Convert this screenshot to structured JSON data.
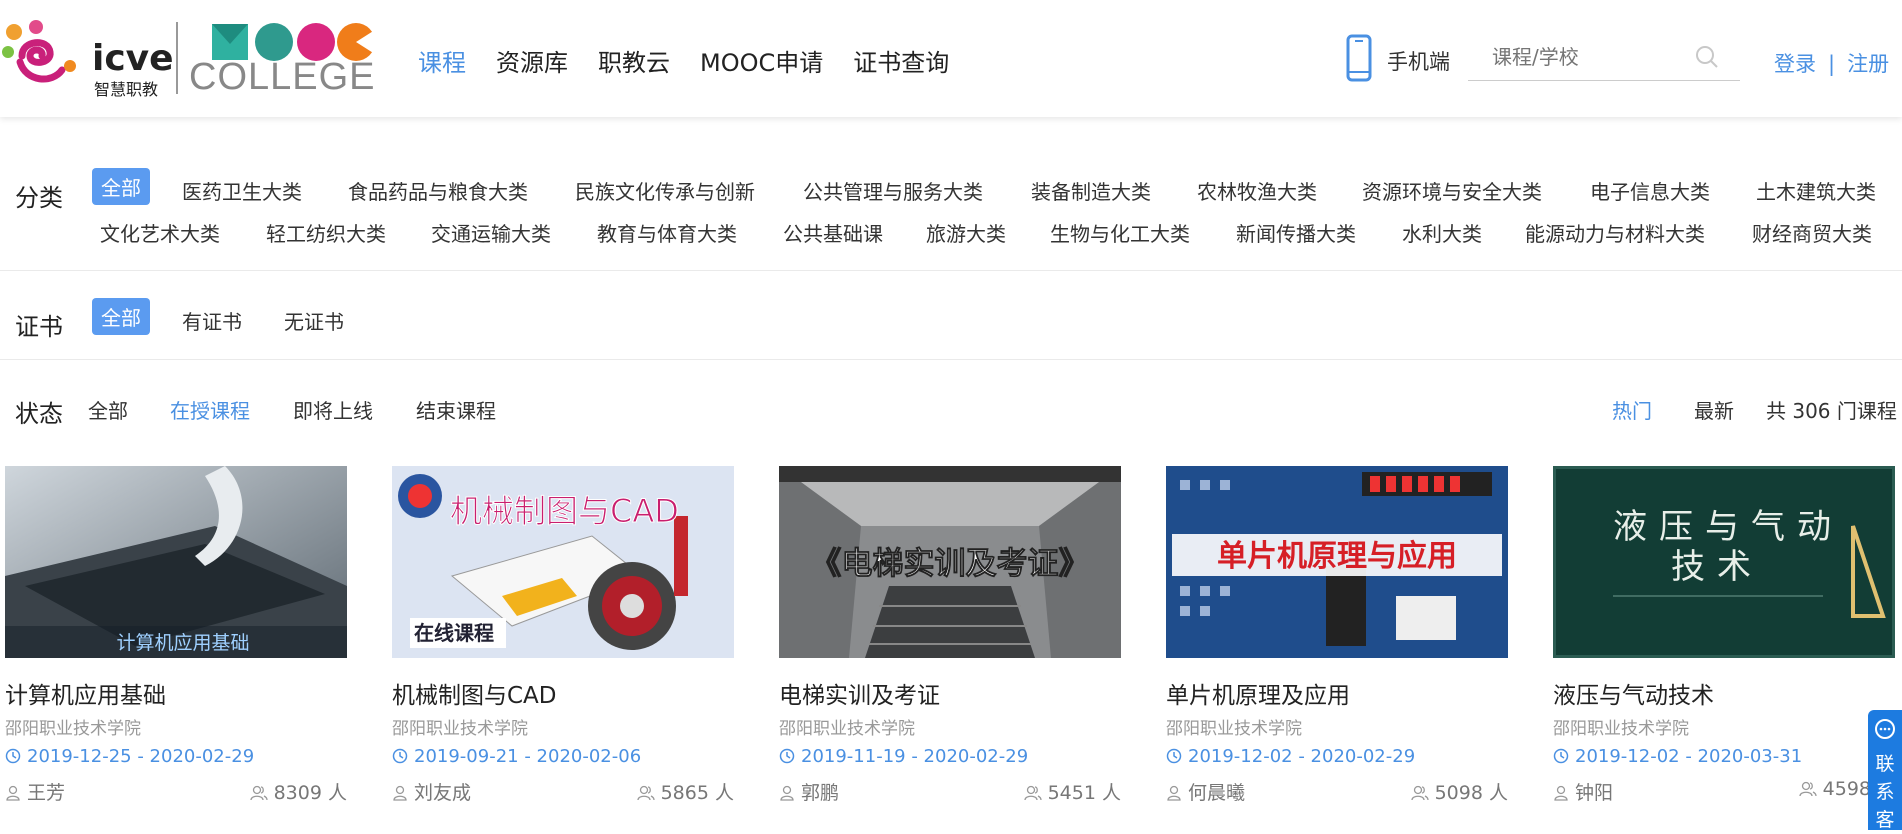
{
  "header": {
    "logo": {
      "icve": "icve",
      "icve_sub": "智慧职教",
      "mooc": "MOOC",
      "college": "COLLEGE"
    },
    "nav": [
      "课程",
      "资源库",
      "职教云",
      "MOOC申请",
      "证书查询"
    ],
    "active_nav": "课程",
    "phone_label": "手机端",
    "search_placeholder": "课程/学校",
    "login": "登录",
    "divider": "|",
    "register": "注册"
  },
  "filters": {
    "category_label": "分类",
    "categories_row1": [
      "全部",
      "医药卫生大类",
      "食品药品与粮食大类",
      "民族文化传承与创新",
      "公共管理与服务大类",
      "装备制造大类",
      "农林牧渔大类",
      "资源环境与安全大类",
      "电子信息大类",
      "土木建筑大类"
    ],
    "categories_row2": [
      "文化艺术大类",
      "轻工纺织大类",
      "交通运输大类",
      "教育与体育大类",
      "公共基础课",
      "旅游大类",
      "生物与化工大类",
      "新闻传播大类",
      "水利大类",
      "能源动力与材料大类",
      "财经商贸大类"
    ],
    "cert_label": "证书",
    "cert_options": [
      "全部",
      "有证书",
      "无证书"
    ],
    "status_label": "状态",
    "status_options": [
      "全部",
      "在授课程",
      "即将上线",
      "结束课程"
    ],
    "sort_hot": "热门",
    "sort_new": "最新",
    "total": "共 306 门课程"
  },
  "courses": [
    {
      "thumb_text": "计算机应用基础",
      "title": "计算机应用基础",
      "school": "邵阳职业技术学院",
      "dates": "2019-12-25 - 2020-02-29",
      "teacher": "王芳",
      "count": "8309 人"
    },
    {
      "thumb_text": "机械制图与CAD",
      "thumb_sub": "在线课程",
      "title": "机械制图与CAD",
      "school": "邵阳职业技术学院",
      "dates": "2019-09-21 - 2020-02-06",
      "teacher": "刘友成",
      "count": "5865 人"
    },
    {
      "thumb_text": "《电梯实训及考证》",
      "title": "电梯实训及考证",
      "school": "邵阳职业技术学院",
      "dates": "2019-11-19 - 2020-02-29",
      "teacher": "郭鹏",
      "count": "5451 人"
    },
    {
      "thumb_text": "单片机原理与应用",
      "title": "单片机原理及应用",
      "school": "邵阳职业技术学院",
      "dates": "2019-12-02 - 2020-02-29",
      "teacher": "何晨曦",
      "count": "5098 人"
    },
    {
      "thumb_text_1": "液压与气动",
      "thumb_text_2": "技术",
      "title": "液压与气动技术",
      "school": "邵阳职业技术学院",
      "dates": "2019-12-02 - 2020-03-31",
      "teacher": "钟阳",
      "count": "4598"
    }
  ],
  "contact": "联系客"
}
